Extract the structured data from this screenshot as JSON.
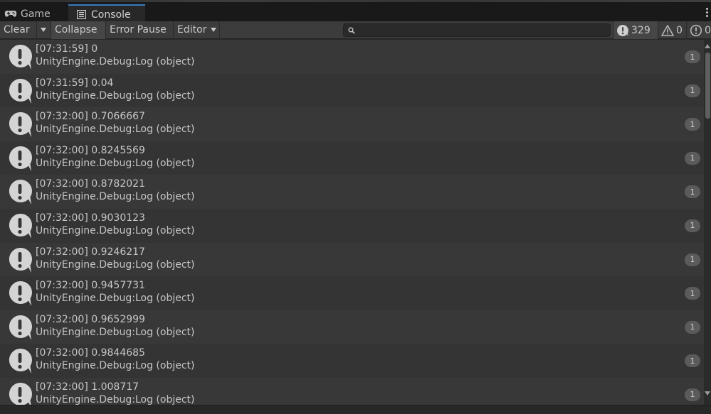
{
  "tabs": [
    {
      "label": "Game",
      "icon": "gamepad-icon",
      "active": false
    },
    {
      "label": "Console",
      "icon": "console-list-icon",
      "active": true
    }
  ],
  "toolbar": {
    "clear_label": "Clear",
    "collapse_label": "Collapse",
    "error_pause_label": "Error Pause",
    "editor_label": "Editor",
    "search_placeholder": "",
    "log_count": "329",
    "warning_count": "0",
    "error_count": "0"
  },
  "colors": {
    "accent_tab": "#3a79bb",
    "row_odd": "#383838",
    "row_even": "#343434",
    "badge": "#5b5b5b"
  },
  "entries": [
    {
      "line1": "[07:31:59] 0",
      "line2": "UnityEngine.Debug:Log (object)",
      "count": "1"
    },
    {
      "line1": "[07:31:59] 0.04",
      "line2": "UnityEngine.Debug:Log (object)",
      "count": "1"
    },
    {
      "line1": "[07:32:00] 0.7066667",
      "line2": "UnityEngine.Debug:Log (object)",
      "count": "1"
    },
    {
      "line1": "[07:32:00] 0.8245569",
      "line2": "UnityEngine.Debug:Log (object)",
      "count": "1"
    },
    {
      "line1": "[07:32:00] 0.8782021",
      "line2": "UnityEngine.Debug:Log (object)",
      "count": "1"
    },
    {
      "line1": "[07:32:00] 0.9030123",
      "line2": "UnityEngine.Debug:Log (object)",
      "count": "1"
    },
    {
      "line1": "[07:32:00] 0.9246217",
      "line2": "UnityEngine.Debug:Log (object)",
      "count": "1"
    },
    {
      "line1": "[07:32:00] 0.9457731",
      "line2": "UnityEngine.Debug:Log (object)",
      "count": "1"
    },
    {
      "line1": "[07:32:00] 0.9652999",
      "line2": "UnityEngine.Debug:Log (object)",
      "count": "1"
    },
    {
      "line1": "[07:32:00] 0.9844685",
      "line2": "UnityEngine.Debug:Log (object)",
      "count": "1"
    },
    {
      "line1": "[07:32:00] 1.008717",
      "line2": "UnityEngine.Debug:Log (object)",
      "count": "1"
    }
  ]
}
